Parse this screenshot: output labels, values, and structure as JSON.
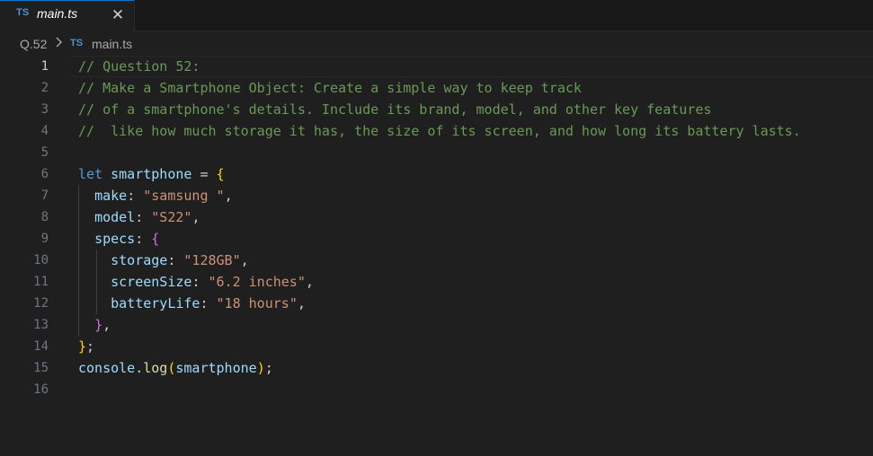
{
  "tab": {
    "icon": "ts-icon",
    "icon_text": "TS",
    "label": "main.ts",
    "close_glyph": "✕"
  },
  "breadcrumb": {
    "folder": "Q.52",
    "separator_icon": "chevron-right-icon",
    "file_icon_text": "TS",
    "file": "main.ts"
  },
  "editor": {
    "active_line": 1,
    "lines": [
      {
        "n": "1",
        "tokens": [
          {
            "t": "// Question 52:",
            "c": "comment"
          }
        ]
      },
      {
        "n": "2",
        "tokens": [
          {
            "t": "// Make a Smartphone Object: Create a simple way to keep track",
            "c": "comment"
          }
        ]
      },
      {
        "n": "3",
        "tokens": [
          {
            "t": "// of a smartphone's details. Include its brand, model, and other key features",
            "c": "comment"
          }
        ]
      },
      {
        "n": "4",
        "tokens": [
          {
            "t": "//  like how much storage it has, the size of its screen, and how long its battery lasts.",
            "c": "comment"
          }
        ]
      },
      {
        "n": "5",
        "tokens": []
      },
      {
        "n": "6",
        "tokens": [
          {
            "t": "let",
            "c": "keyword"
          },
          {
            "t": " ",
            "c": "punc"
          },
          {
            "t": "smartphone",
            "c": "var"
          },
          {
            "t": " = ",
            "c": "punc"
          },
          {
            "t": "{",
            "c": "brace1"
          }
        ]
      },
      {
        "n": "7",
        "tokens": [
          {
            "t": "  ",
            "c": "punc"
          },
          {
            "t": "make",
            "c": "prop"
          },
          {
            "t": ": ",
            "c": "punc"
          },
          {
            "t": "\"samsung \"",
            "c": "string"
          },
          {
            "t": ",",
            "c": "punc"
          }
        ]
      },
      {
        "n": "8",
        "tokens": [
          {
            "t": "  ",
            "c": "punc"
          },
          {
            "t": "model",
            "c": "prop"
          },
          {
            "t": ": ",
            "c": "punc"
          },
          {
            "t": "\"S22\"",
            "c": "string"
          },
          {
            "t": ",",
            "c": "punc"
          }
        ]
      },
      {
        "n": "9",
        "tokens": [
          {
            "t": "  ",
            "c": "punc"
          },
          {
            "t": "specs",
            "c": "prop"
          },
          {
            "t": ": ",
            "c": "punc"
          },
          {
            "t": "{",
            "c": "brace2"
          }
        ]
      },
      {
        "n": "10",
        "tokens": [
          {
            "t": "    ",
            "c": "punc"
          },
          {
            "t": "storage",
            "c": "prop"
          },
          {
            "t": ": ",
            "c": "punc"
          },
          {
            "t": "\"128GB\"",
            "c": "string"
          },
          {
            "t": ",",
            "c": "punc"
          }
        ]
      },
      {
        "n": "11",
        "tokens": [
          {
            "t": "    ",
            "c": "punc"
          },
          {
            "t": "screenSize",
            "c": "prop"
          },
          {
            "t": ": ",
            "c": "punc"
          },
          {
            "t": "\"6.2 inches\"",
            "c": "string"
          },
          {
            "t": ",",
            "c": "punc"
          }
        ]
      },
      {
        "n": "12",
        "tokens": [
          {
            "t": "    ",
            "c": "punc"
          },
          {
            "t": "batteryLife",
            "c": "prop"
          },
          {
            "t": ": ",
            "c": "punc"
          },
          {
            "t": "\"18 hours\"",
            "c": "string"
          },
          {
            "t": ",",
            "c": "punc"
          }
        ]
      },
      {
        "n": "13",
        "tokens": [
          {
            "t": "  ",
            "c": "punc"
          },
          {
            "t": "}",
            "c": "brace2"
          },
          {
            "t": ",",
            "c": "punc"
          }
        ]
      },
      {
        "n": "14",
        "tokens": [
          {
            "t": "}",
            "c": "brace1"
          },
          {
            "t": ";",
            "c": "punc"
          }
        ]
      },
      {
        "n": "15",
        "tokens": [
          {
            "t": "console",
            "c": "var"
          },
          {
            "t": ".",
            "c": "punc"
          },
          {
            "t": "log",
            "c": "func"
          },
          {
            "t": "(",
            "c": "brace1"
          },
          {
            "t": "smartphone",
            "c": "var"
          },
          {
            "t": ")",
            "c": "brace1"
          },
          {
            "t": ";",
            "c": "punc"
          }
        ]
      },
      {
        "n": "16",
        "tokens": []
      }
    ]
  },
  "colors": {
    "background": "#1f1f1f",
    "tab_bar": "#181818",
    "comment": "#6a9955",
    "keyword": "#569cd6",
    "variable": "#9cdcfe",
    "string": "#ce9178",
    "brace_level1": "#ffd700",
    "brace_level2": "#da70d6",
    "function": "#dcdcaa",
    "ts_icon": "#4e94ce"
  }
}
